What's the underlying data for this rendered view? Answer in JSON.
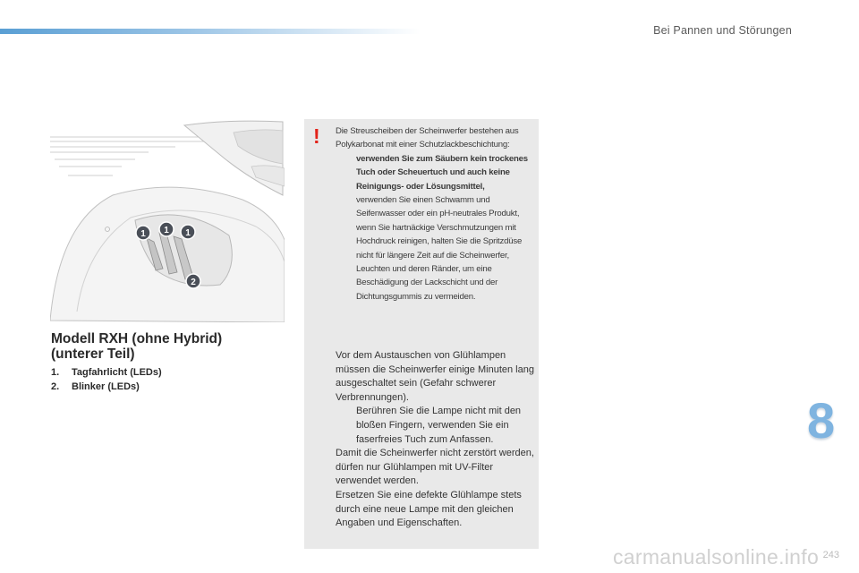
{
  "header": {
    "section_title": "Bei Pannen und Störungen"
  },
  "illustration": {
    "callouts": [
      "1",
      "1",
      "1",
      "2"
    ]
  },
  "model": {
    "title_line1": "Modell RXH (ohne Hybrid)",
    "title_line2": "(unterer Teil)",
    "parts": [
      {
        "num": "1.",
        "label": "Tagfahrlicht (LEDs)"
      },
      {
        "num": "2.",
        "label": "Blinker (LEDs)"
      }
    ]
  },
  "caution": {
    "mark": "!",
    "intro": "Die Streuscheiben der Scheinwerfer bestehen aus Polykarbonat mit einer Schutzlackbeschichtung:",
    "bullet_glyph": "",
    "bullets": [
      "verwenden Sie zum Säubern kein trockenes Tuch oder Scheuertuch und auch keine Reinigungs- oder Lösungsmittel,",
      "verwenden Sie einen Schwamm und Seifenwasser oder ein pH-neutrales Produkt,",
      "wenn Sie hartnäckige Verschmutzungen mit Hochdruck reinigen, halten Sie die Spritzdüse nicht für längere Zeit auf die Scheinwerfer, Leuchten und deren Ränder, um eine Beschädigung der Lackschicht und der Dichtungsgummis zu vermeiden."
    ]
  },
  "lamp_info": {
    "para1": "Vor dem Austauschen von Glühlampen müssen die Scheinwerfer einige Minuten lang ausgeschaltet sein (Gefahr schwerer Verbrennungen).",
    "bullet": "Berühren Sie die Lampe nicht mit den bloßen Fingern, verwenden Sie ein faserfreies Tuch zum Anfassen.",
    "para2": "Damit die Scheinwerfer nicht zerstört werden, dürfen nur Glühlampen mit UV-Filter verwendet werden.",
    "para3": "Ersetzen Sie eine defekte Glühlampe stets durch eine neue Lampe mit den gleichen Angaben und Eigenschaften."
  },
  "chapter_number": "8",
  "page_number": "243",
  "watermark": "carmanualsonline.info",
  "colors": {
    "accent_blue": "#7fb4e0",
    "warning_red": "#e2231a",
    "note_bg": "#e9e9e9"
  }
}
